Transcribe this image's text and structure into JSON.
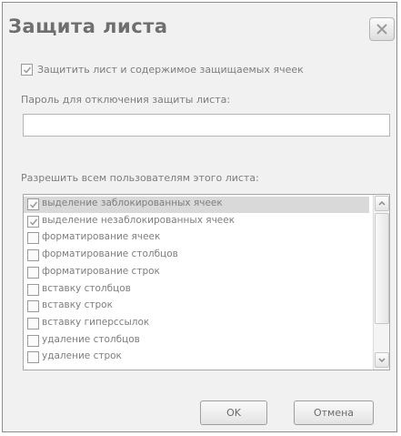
{
  "dialog": {
    "title": "Защита листа",
    "protect_checkbox": {
      "label": "Защитить лист и содержимое защищаемых ячеек",
      "checked": true
    },
    "password": {
      "label": "Пароль для отключения защиты листа:",
      "value": ""
    },
    "permissions": {
      "label": "Разрешить всем пользователям этого листа:",
      "items": [
        {
          "label": "выделение заблокированных ячеек",
          "checked": true
        },
        {
          "label": "выделение незаблокированных ячеек",
          "checked": true
        },
        {
          "label": "форматирование ячеек",
          "checked": false
        },
        {
          "label": "форматирование столбцов",
          "checked": false
        },
        {
          "label": "форматирование строк",
          "checked": false
        },
        {
          "label": "вставку столбцов",
          "checked": false
        },
        {
          "label": "вставку строк",
          "checked": false
        },
        {
          "label": "вставку гиперссылок",
          "checked": false
        },
        {
          "label": "удаление столбцов",
          "checked": false
        },
        {
          "label": "удаление строк",
          "checked": false
        }
      ]
    },
    "ok_label": "OK",
    "cancel_label": "Отмена"
  },
  "colors": {
    "dialog_bg": "#f1f1f1",
    "text": "#7d7d7d",
    "selected_row": "#d9d9d9"
  },
  "icons": {
    "close": "close-icon",
    "check": "checkmark-icon",
    "scroll_up": "chevron-up-icon",
    "scroll_down": "chevron-down-icon"
  }
}
